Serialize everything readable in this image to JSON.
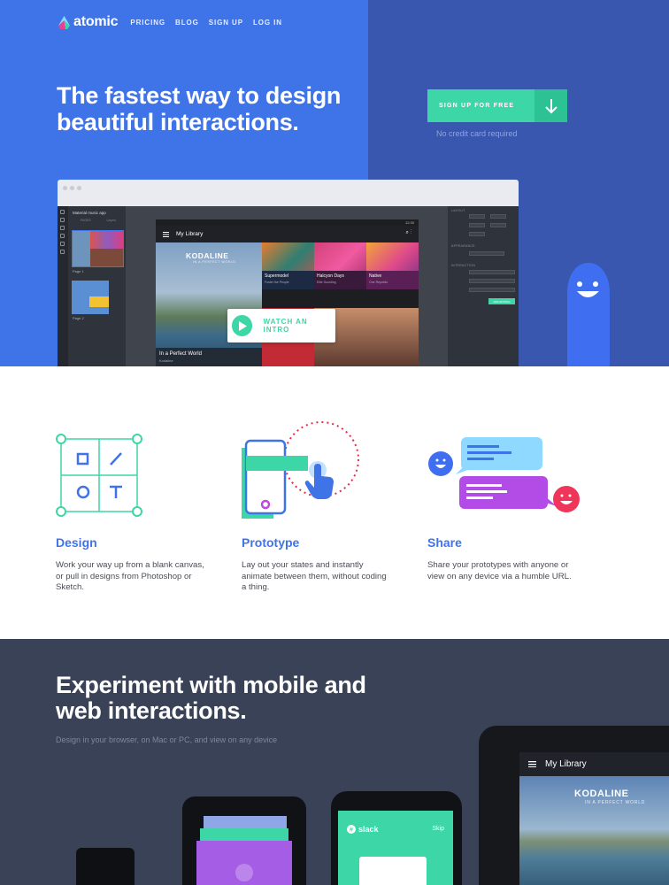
{
  "nav": {
    "logo": "atomic",
    "links": [
      "PRICING",
      "BLOG",
      "SIGN UP",
      "LOG IN"
    ]
  },
  "hero": {
    "headline": "The fastest way to design beautiful interactions.",
    "cta_label": "SIGN UP FOR FREE",
    "cta_note": "No credit card required",
    "watch_label": "WATCH AN INTRO"
  },
  "app_window": {
    "project_title": "Material music app",
    "pages_tabs": [
      "PAGES",
      "Layers"
    ],
    "page_labels": [
      "Page 1",
      "Page 2"
    ],
    "canvas_title": "My Library",
    "status_time": "12:30",
    "props": [
      "LAYOUT",
      "APPEARANCE",
      "INTERACTION"
    ],
    "prop_values": {
      "x": "380",
      "y": "380",
      "w": "340",
      "h": "336",
      "rotate": "0",
      "radius": "0",
      "on": "Click or Tap",
      "goto": "Page 2",
      "motion": "Advanced motion",
      "duration": "1000"
    },
    "prop_button": "ADD EDITING",
    "tiles": [
      {
        "title": "In a Perfect World",
        "subtitle": "Kodaline",
        "art_title": "KODALINE",
        "art_sub": "IN A PERFECT WORLD"
      },
      {
        "title": "Supermodel",
        "subtitle": "Foster the People"
      },
      {
        "title": "Halcyon Days",
        "subtitle": "Ellie Goulding"
      },
      {
        "title": "Native",
        "subtitle": "One Republic"
      }
    ]
  },
  "features": [
    {
      "title": "Design",
      "desc": "Work your way up from a blank canvas, or pull in designs from Photoshop or Sketch."
    },
    {
      "title": "Prototype",
      "desc": "Lay out your states and instantly animate between them, without coding a thing."
    },
    {
      "title": "Share",
      "desc": "Share your prototypes with anyone or view on any device via a humble URL."
    }
  ],
  "devices": {
    "headline": "Experiment with mobile and web interactions.",
    "subtitle": "Design in your browser, on Mac or PC, and view on any device",
    "tablet_title": "My Library",
    "tablet_art_title": "KODALINE",
    "tablet_art_sub": "IN A PERFECT WORLD",
    "iphone_app": "slack",
    "iphone_skip": "Skip"
  },
  "colors": {
    "hero_blue": "#3f74e8",
    "hero_dark_blue": "#3a57b0",
    "accent_green": "#3dd6a6",
    "dark_section": "#3a4257"
  }
}
